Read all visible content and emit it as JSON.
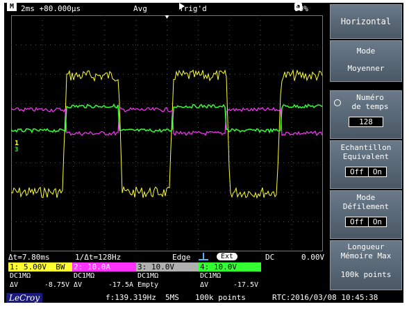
{
  "top_bar": {
    "mode_icon_letter": "M",
    "timebase": "2ms +80.000µs",
    "acquisition": "Avg",
    "trigger_state": "Trig'd",
    "battery": "99%"
  },
  "measure_line": {
    "delta_t": "Δt=7.80ms",
    "inv_delta_t": "1/Δt=128Hz",
    "trigger_type": "Edge",
    "trigger_source": "Ext",
    "coupling": "DC",
    "trigger_level": "0.00V"
  },
  "channels": [
    {
      "label": "1: 5.00V  BW",
      "coupling": "DC1MΩ",
      "dv": "ΔV",
      "value": "-8.75V",
      "color": "#ffff33"
    },
    {
      "label": "2: 10.0A",
      "coupling": "DC1MΩ",
      "dv": "ΔV",
      "value": "-17.5A",
      "color": "#ff33ff"
    },
    {
      "label": "3: 10.0V",
      "coupling": "DC1MΩ",
      "dv": "Empty",
      "value": "",
      "color": "#b0b0b0"
    },
    {
      "label": "4: 10.0V",
      "coupling": "DC1MΩ",
      "dv": "ΔV",
      "value": "-17.5V",
      "color": "#33ff33"
    }
  ],
  "bottom_bar": {
    "brand": "LeCroy",
    "frequency": "f:139.319Hz",
    "sample_rate": "5MS",
    "points": "100k points",
    "rtc": "RTC:2016/03/08 10:45:38"
  },
  "menu": {
    "title": "Horizontal",
    "mode_label": "Mode",
    "mode_value": "Moyenner",
    "averages_label_1": "Numéro",
    "averages_label_2": "de temps",
    "averages_value": "128",
    "equiv_label_1": "Echantillon",
    "equiv_label_2": "Equivalent",
    "equiv_off": "Off",
    "equiv_on": "On",
    "scroll_label_1": "Mode",
    "scroll_label_2": "Défilement",
    "scroll_off": "Off",
    "scroll_on": "On",
    "maxlen_label_1": "Longueur",
    "maxlen_label_2": "Mémoire Max",
    "maxlen_value": "100k points"
  },
  "markers": {
    "ch1": "1",
    "ch3": "3"
  },
  "colors": {
    "ch1": "#ffff33",
    "ch2": "#ff33ff",
    "ch4": "#33ff33",
    "trigger_edge": "#4fb0ff"
  }
}
